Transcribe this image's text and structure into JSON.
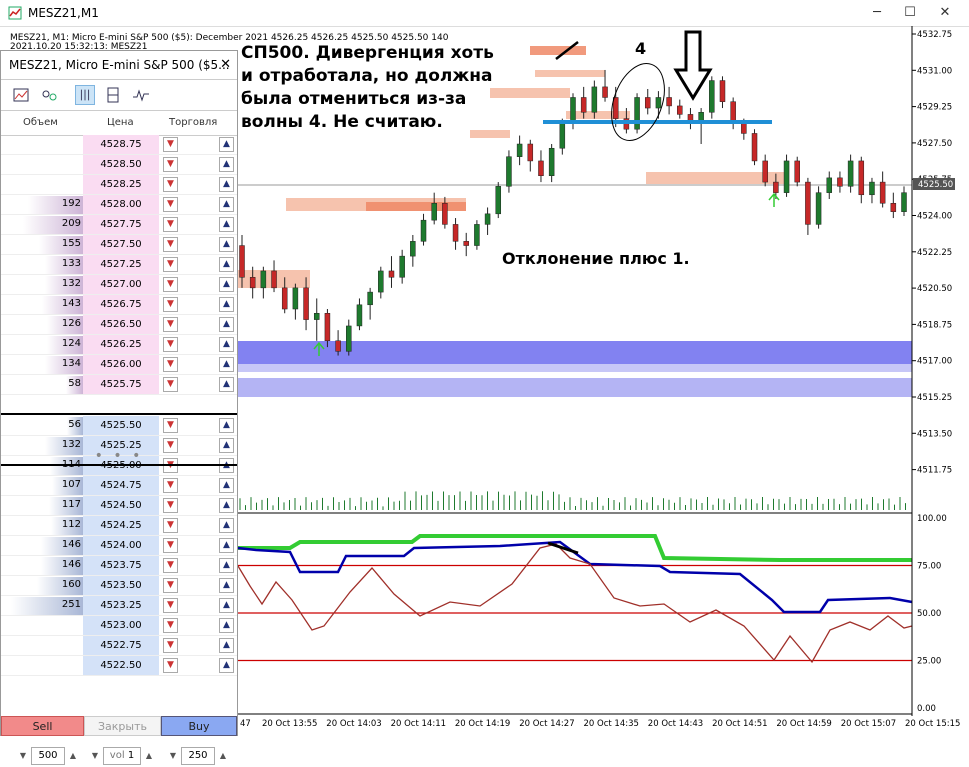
{
  "window": {
    "title": "MESZ21,M1",
    "minimize": "─",
    "maximize": "☐",
    "close": "✕"
  },
  "chart": {
    "header_line1": "MESZ21, M1:  Micro E-mini S&P 500 ($5): December 2021  4526.25 4526.25 4525.50 4525.50  140",
    "header_line2": "2021.10.20 15:32:13: MESZ21",
    "current_price_label": "4525.50",
    "price_axis": [
      "4532.75",
      "4531.00",
      "4529.25",
      "4527.50",
      "4525.75",
      "4524.00",
      "4522.25",
      "4520.50",
      "4518.75",
      "4517.00",
      "4515.25",
      "4513.50",
      "4511.75"
    ],
    "osc_axis": [
      "100.00",
      "75.00",
      "50.00",
      "25.00",
      "0.00"
    ],
    "time_axis": [
      "47",
      "20 Oct 13:55",
      "20 Oct 14:03",
      "20 Oct 14:11",
      "20 Oct 14:19",
      "20 Oct 14:27",
      "20 Oct 14:35",
      "20 Oct 14:43",
      "20 Oct 14:51",
      "20 Oct 14:59",
      "20 Oct 15:07",
      "20 Oct 15:15"
    ],
    "colors": {
      "bull": "#1e7a2e",
      "bear": "#c62828",
      "zone_orange": "#f5b8a0",
      "zone_blue": "#7b7bf0",
      "osc_green": "#33cc33",
      "osc_blue": "#0000aa",
      "osc_brown": "#a0302a",
      "level_red": "#cc0000",
      "hline_blue": "#1f8fd6"
    },
    "chart_data": {
      "type": "candlestick",
      "ylim": [
        4510.5,
        4533.0
      ],
      "candles": [
        [
          4523.0,
          4523.5,
          4521.0,
          4521.5
        ],
        [
          4521.5,
          4522.0,
          4520.5,
          4521.0
        ],
        [
          4521.0,
          4522.0,
          4520.5,
          4521.8
        ],
        [
          4521.8,
          4522.3,
          4520.8,
          4521.0
        ],
        [
          4521.0,
          4521.5,
          4519.8,
          4520.0
        ],
        [
          4520.0,
          4521.2,
          4519.5,
          4521.0
        ],
        [
          4521.0,
          4521.5,
          4519.0,
          4519.5
        ],
        [
          4519.5,
          4520.5,
          4518.5,
          4519.8
        ],
        [
          4519.8,
          4520.0,
          4518.2,
          4518.5
        ],
        [
          4518.5,
          4519.0,
          4517.8,
          4518.0
        ],
        [
          4518.0,
          4519.5,
          4517.8,
          4519.2
        ],
        [
          4519.2,
          4520.5,
          4519.0,
          4520.2
        ],
        [
          4520.2,
          4521.0,
          4519.5,
          4520.8
        ],
        [
          4520.8,
          4522.0,
          4520.5,
          4521.8
        ],
        [
          4521.8,
          4522.5,
          4521.0,
          4521.5
        ],
        [
          4521.5,
          4522.8,
          4521.2,
          4522.5
        ],
        [
          4522.5,
          4523.5,
          4522.0,
          4523.2
        ],
        [
          4523.2,
          4524.5,
          4523.0,
          4524.2
        ],
        [
          4524.2,
          4525.5,
          4524.0,
          4525.0
        ],
        [
          4525.0,
          4525.3,
          4523.8,
          4524.0
        ],
        [
          4524.0,
          4524.3,
          4522.8,
          4523.2
        ],
        [
          4523.2,
          4523.6,
          4522.5,
          4523.0
        ],
        [
          4523.0,
          4524.2,
          4522.8,
          4524.0
        ],
        [
          4524.0,
          4524.8,
          4523.5,
          4524.5
        ],
        [
          4524.5,
          4526.0,
          4524.3,
          4525.8
        ],
        [
          4525.8,
          4527.5,
          4525.5,
          4527.2
        ],
        [
          4527.2,
          4528.2,
          4526.8,
          4527.8
        ],
        [
          4527.8,
          4528.0,
          4526.5,
          4527.0
        ],
        [
          4527.0,
          4527.5,
          4526.0,
          4526.3
        ],
        [
          4526.3,
          4527.8,
          4526.0,
          4527.6
        ],
        [
          4527.6,
          4529.0,
          4527.3,
          4528.8
        ],
        [
          4528.8,
          4530.2,
          4528.5,
          4530.0
        ],
        [
          4530.0,
          4530.5,
          4529.0,
          4529.3
        ],
        [
          4529.3,
          4530.8,
          4529.0,
          4530.5
        ],
        [
          4530.5,
          4531.3,
          4529.8,
          4530.0
        ],
        [
          4530.0,
          4530.5,
          4528.6,
          4529.0
        ],
        [
          4529.0,
          4529.5,
          4528.3,
          4528.5
        ],
        [
          4528.5,
          4530.2,
          4528.3,
          4530.0
        ],
        [
          4530.0,
          4530.4,
          4529.2,
          4529.5
        ],
        [
          4529.5,
          4530.3,
          4529.0,
          4530.0
        ],
        [
          4530.0,
          4530.5,
          4529.2,
          4529.6
        ],
        [
          4529.6,
          4529.9,
          4529.0,
          4529.2
        ],
        [
          4529.2,
          4529.5,
          4528.5,
          4528.8
        ],
        [
          4528.8,
          4529.5,
          4527.8,
          4529.3
        ],
        [
          4529.3,
          4531.0,
          4529.0,
          4530.8
        ],
        [
          4530.8,
          4531.0,
          4529.5,
          4529.8
        ],
        [
          4529.8,
          4530.0,
          4528.5,
          4528.8
        ],
        [
          4528.8,
          4529.0,
          4528.0,
          4528.3
        ],
        [
          4528.3,
          4528.5,
          4526.8,
          4527.0
        ],
        [
          4527.0,
          4527.3,
          4525.8,
          4526.0
        ],
        [
          4526.0,
          4526.4,
          4525.2,
          4525.5
        ],
        [
          4525.5,
          4527.3,
          4525.3,
          4527.0
        ],
        [
          4527.0,
          4527.2,
          4525.8,
          4526.0
        ],
        [
          4526.0,
          4526.2,
          4523.5,
          4524.0
        ],
        [
          4524.0,
          4525.8,
          4523.8,
          4525.5
        ],
        [
          4525.5,
          4526.5,
          4525.2,
          4526.2
        ],
        [
          4526.2,
          4526.5,
          4525.5,
          4525.8
        ],
        [
          4525.8,
          4527.3,
          4525.5,
          4527.0
        ],
        [
          4527.0,
          4527.2,
          4525.0,
          4525.4
        ],
        [
          4525.4,
          4526.2,
          4525.0,
          4526.0
        ],
        [
          4526.0,
          4526.5,
          4524.8,
          4525.0
        ],
        [
          4525.0,
          4525.5,
          4524.3,
          4524.6
        ],
        [
          4524.6,
          4525.8,
          4524.4,
          4525.5
        ]
      ],
      "oscillator": {
        "levels": [
          75,
          50,
          25
        ],
        "ylim": [
          0,
          100
        ]
      }
    }
  },
  "annotations": {
    "main": "СП500. Дивергенция хоть\nи отработала, но должна\nбыла отмениться из-за\nволны 4. Не считаю.",
    "deviation": "Отклонение плюс 1.",
    "wave": "4"
  },
  "dom": {
    "title": "MESZ21, Micro E-mini S&P 500 ($5...",
    "close": "✕",
    "columns": {
      "volume": "Объем",
      "price": "Цена",
      "trade": "Торговля"
    },
    "asks": [
      {
        "price": "4528.75",
        "volume": ""
      },
      {
        "price": "4528.50",
        "volume": ""
      },
      {
        "price": "4528.25",
        "volume": ""
      },
      {
        "price": "4528.00",
        "volume": "192"
      },
      {
        "price": "4527.75",
        "volume": "209"
      },
      {
        "price": "4527.50",
        "volume": "155"
      },
      {
        "price": "4527.25",
        "volume": "133"
      },
      {
        "price": "4527.00",
        "volume": "132"
      },
      {
        "price": "4526.75",
        "volume": "143"
      },
      {
        "price": "4526.50",
        "volume": "126"
      },
      {
        "price": "4526.25",
        "volume": "124"
      },
      {
        "price": "4526.00",
        "volume": "134"
      },
      {
        "price": "4525.75",
        "volume": "58"
      }
    ],
    "bids": [
      {
        "price": "4525.50",
        "volume": "56"
      },
      {
        "price": "4525.25",
        "volume": "132"
      },
      {
        "price": "4525.00",
        "volume": "114"
      },
      {
        "price": "4524.75",
        "volume": "107"
      },
      {
        "price": "4524.50",
        "volume": "117"
      },
      {
        "price": "4524.25",
        "volume": "112"
      },
      {
        "price": "4524.00",
        "volume": "146"
      },
      {
        "price": "4523.75",
        "volume": "146"
      },
      {
        "price": "4523.50",
        "volume": "160"
      },
      {
        "price": "4523.25",
        "volume": "251"
      },
      {
        "price": "4523.00",
        "volume": ""
      },
      {
        "price": "4522.75",
        "volume": ""
      },
      {
        "price": "4522.50",
        "volume": ""
      }
    ],
    "dots": "• • •",
    "lot_value": "500",
    "vol_label": "vol",
    "vol_value": "1",
    "depth_value": "250",
    "sell_label": "Sell",
    "close_label": "Закрыть",
    "buy_label": "Buy"
  }
}
